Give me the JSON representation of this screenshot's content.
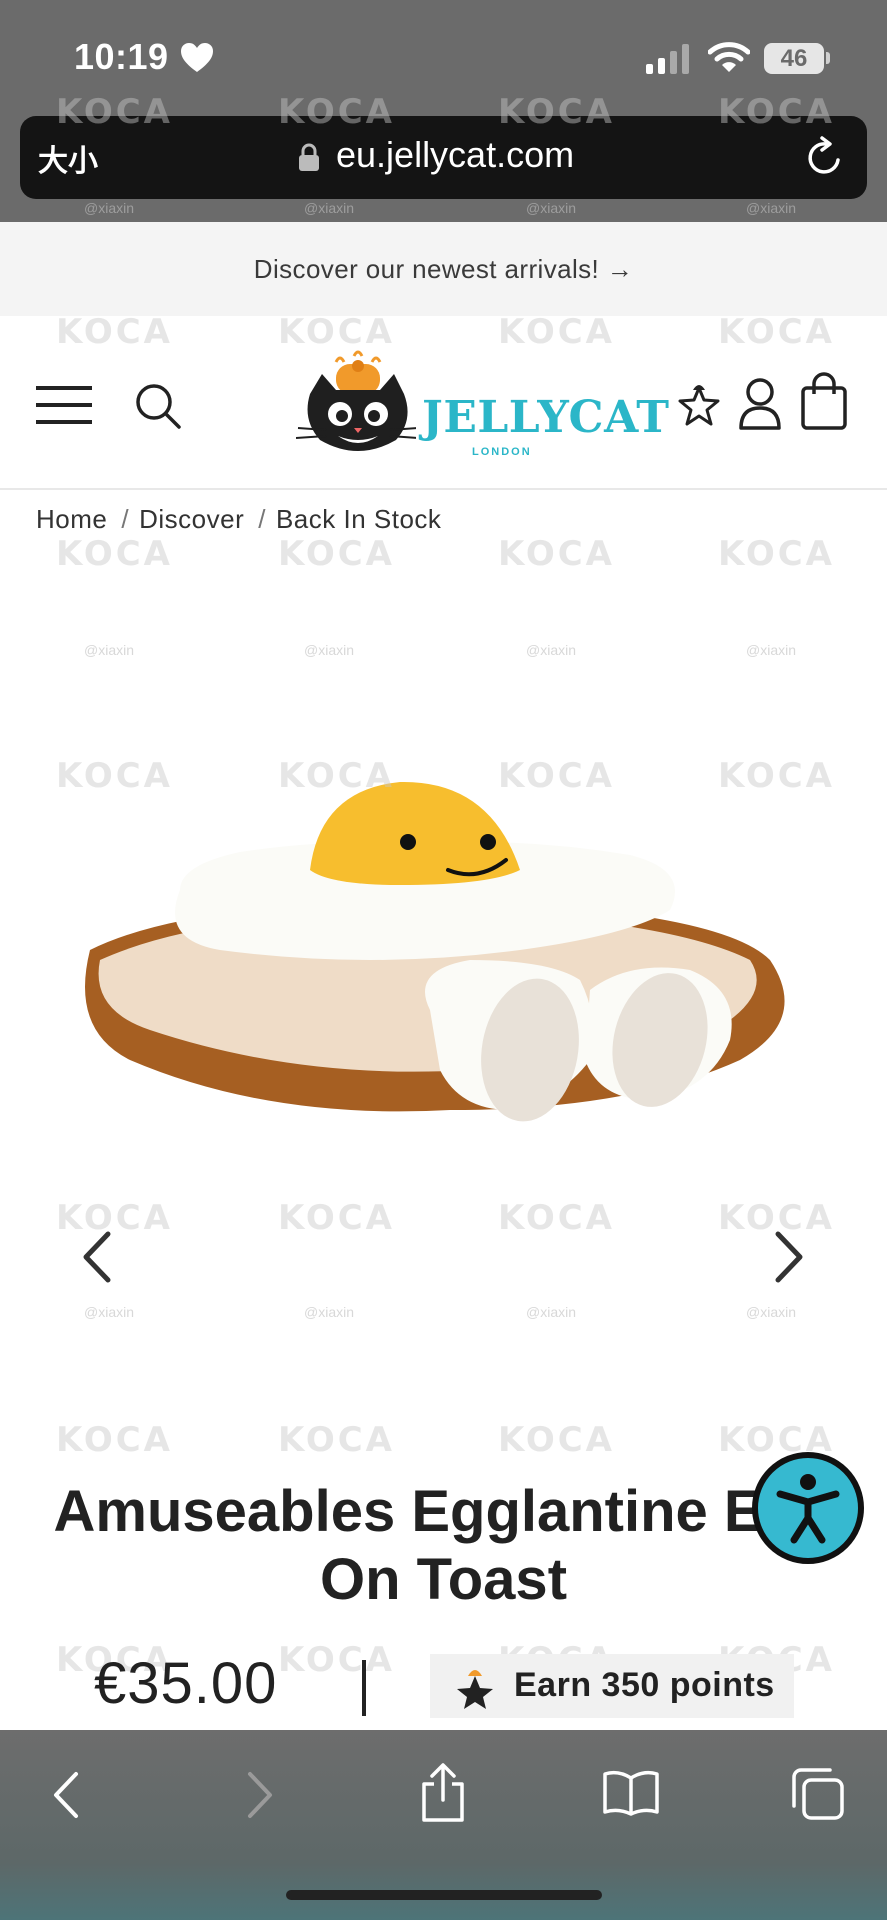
{
  "status_bar": {
    "time": "10:19",
    "battery": "46"
  },
  "browser": {
    "text_size_label": "大小",
    "url": "eu.jellycat.com"
  },
  "announcement": {
    "text": "Discover our newest arrivals! →"
  },
  "logo": {
    "wordmark": "JELLYCAT",
    "subline": "LONDON"
  },
  "breadcrumb": {
    "items": [
      "Home",
      "Discover",
      "Back In Stock"
    ],
    "separator": "/"
  },
  "product": {
    "title_line1": "Amuseables Egglantine Egg",
    "title_line2": "On Toast",
    "price": "€35.00",
    "points": "Earn 350 points"
  },
  "watermark": {
    "brand": "KOCA",
    "handle": "@xiaxin"
  },
  "colors": {
    "accent": "#2bb6c8",
    "accessibility": "#36b9d0",
    "chrome": "#6b6b6b"
  },
  "icons": [
    "heart-icon",
    "signal-icon",
    "wifi-icon",
    "lock-icon",
    "reload-icon",
    "menu-icon",
    "search-icon",
    "wishlist-star-icon",
    "account-icon",
    "bag-icon",
    "prev-arrow-icon",
    "next-arrow-icon",
    "accessibility-icon",
    "back-icon",
    "forward-icon",
    "share-icon",
    "bookmarks-icon",
    "tabs-icon"
  ]
}
